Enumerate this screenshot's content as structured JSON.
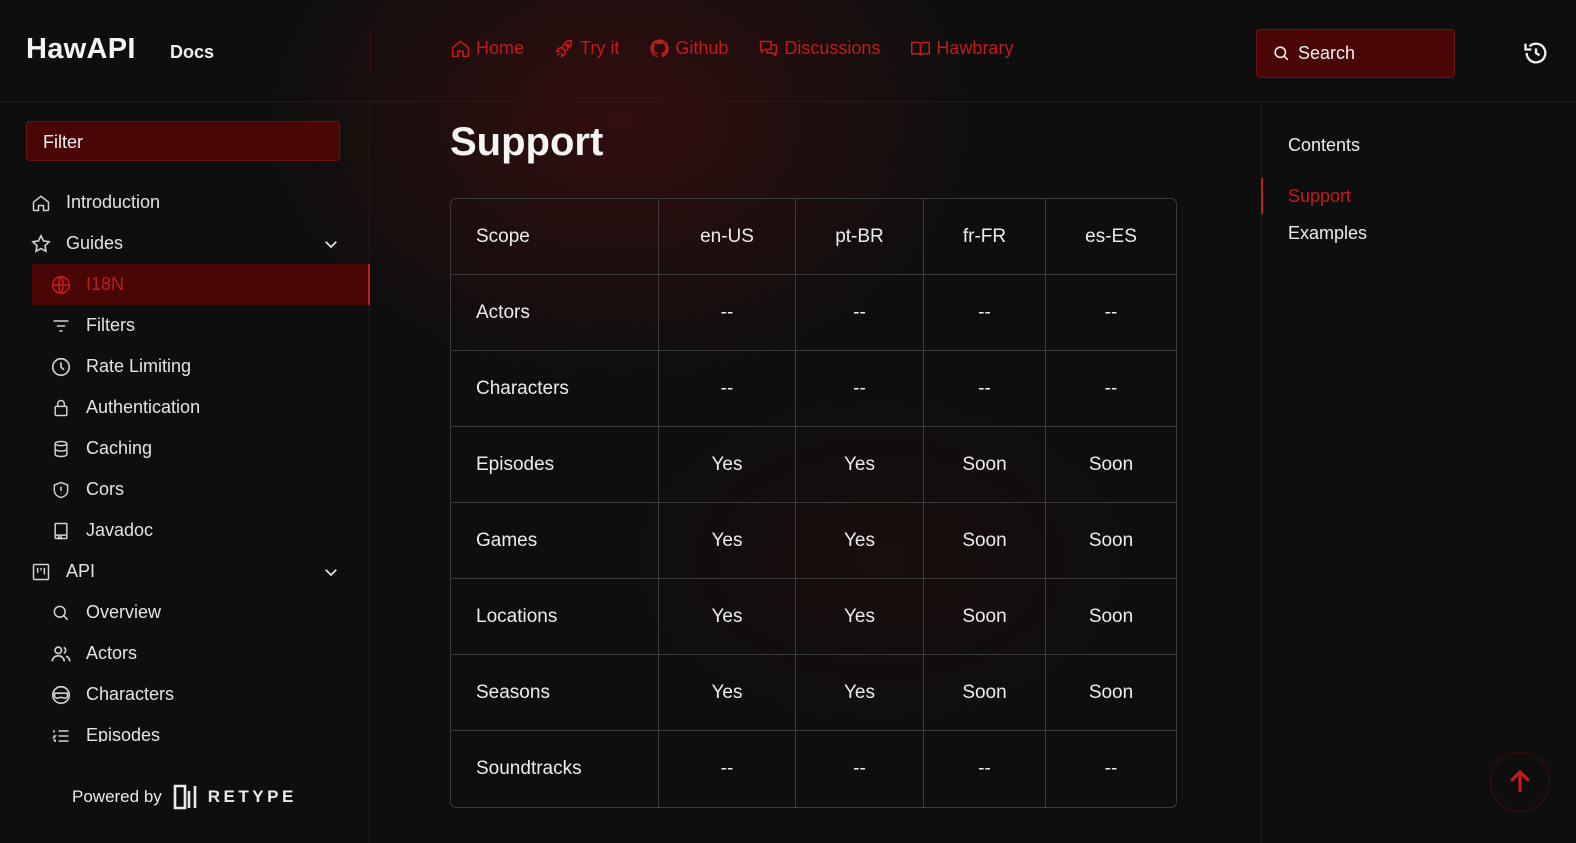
{
  "header": {
    "brand": "HawAPI",
    "docs_label": "Docs",
    "nav": [
      {
        "label": "Home",
        "icon": "home-icon"
      },
      {
        "label": "Try it",
        "icon": "rocket-icon"
      },
      {
        "label": "Github",
        "icon": "github-icon"
      },
      {
        "label": "Discussions",
        "icon": "discussions-icon"
      },
      {
        "label": "Hawbrary",
        "icon": "book-icon"
      }
    ],
    "search_placeholder": "Search",
    "accent_color": "#c21b1b"
  },
  "sidebar": {
    "filter_placeholder": "Filter",
    "items": [
      {
        "label": "Introduction",
        "icon": "home-icon",
        "level": "top"
      },
      {
        "label": "Guides",
        "icon": "star-icon",
        "level": "top",
        "expanded": true
      },
      {
        "label": "I18N",
        "icon": "globe-icon",
        "level": "sub",
        "active": true
      },
      {
        "label": "Filters",
        "icon": "filter-icon",
        "level": "sub"
      },
      {
        "label": "Rate Limiting",
        "icon": "clock-icon",
        "level": "sub"
      },
      {
        "label": "Authentication",
        "icon": "lock-icon",
        "level": "sub"
      },
      {
        "label": "Caching",
        "icon": "database-icon",
        "level": "sub"
      },
      {
        "label": "Cors",
        "icon": "shield-icon",
        "level": "sub"
      },
      {
        "label": "Javadoc",
        "icon": "book-icon",
        "level": "sub"
      },
      {
        "label": "API",
        "icon": "project-icon",
        "level": "top",
        "expanded": true
      },
      {
        "label": "Overview",
        "icon": "search-icon",
        "level": "sub"
      },
      {
        "label": "Actors",
        "icon": "people-icon",
        "level": "sub"
      },
      {
        "label": "Characters",
        "icon": "mask-icon",
        "level": "sub"
      },
      {
        "label": "Episodes",
        "icon": "list-icon",
        "level": "sub"
      }
    ],
    "powered_by": "Powered by",
    "powered_brand": "RETYPE"
  },
  "main": {
    "title": "Support",
    "table": {
      "headers": [
        "Scope",
        "en-US",
        "pt-BR",
        "fr-FR",
        "es-ES"
      ],
      "rows": [
        [
          "Actors",
          "--",
          "--",
          "--",
          "--"
        ],
        [
          "Characters",
          "--",
          "--",
          "--",
          "--"
        ],
        [
          "Episodes",
          "Yes",
          "Yes",
          "Soon",
          "Soon"
        ],
        [
          "Games",
          "Yes",
          "Yes",
          "Soon",
          "Soon"
        ],
        [
          "Locations",
          "Yes",
          "Yes",
          "Soon",
          "Soon"
        ],
        [
          "Seasons",
          "Yes",
          "Yes",
          "Soon",
          "Soon"
        ],
        [
          "Soundtracks",
          "--",
          "--",
          "--",
          "--"
        ]
      ]
    }
  },
  "toc": {
    "heading": "Contents",
    "items": [
      {
        "label": "Support",
        "active": true
      },
      {
        "label": "Examples",
        "active": false
      }
    ]
  }
}
